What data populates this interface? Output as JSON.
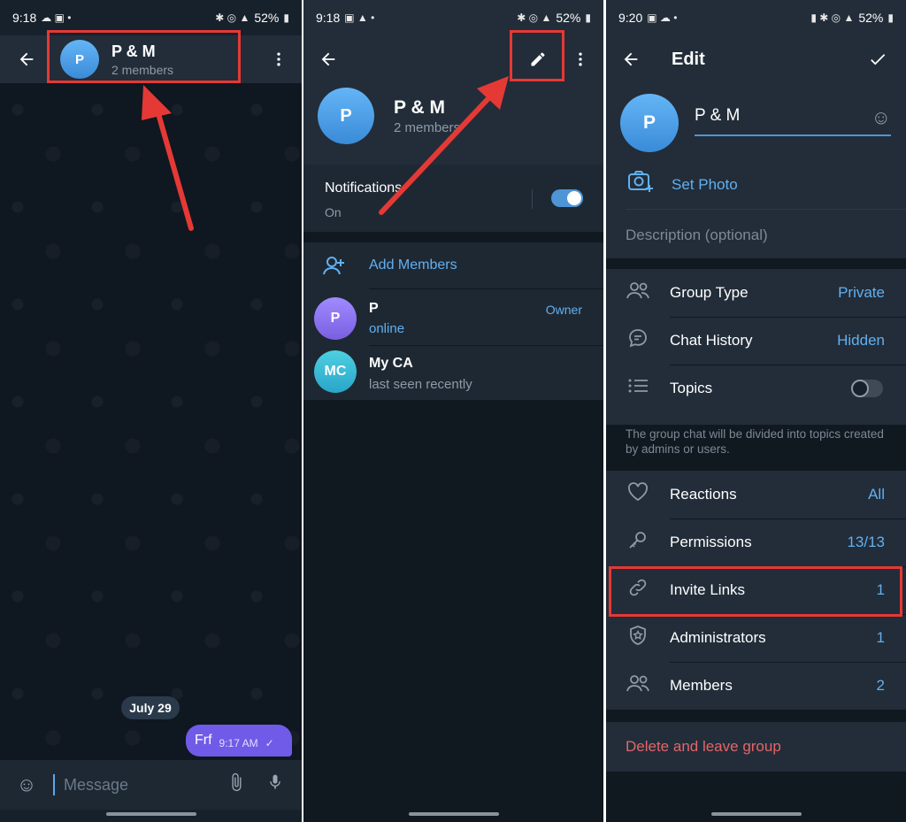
{
  "status_bar": [
    {
      "time": "9:18",
      "battery": "52%"
    },
    {
      "time": "9:18",
      "battery": "52%"
    },
    {
      "time": "9:20",
      "battery": "52%"
    }
  ],
  "chat": {
    "title": "P & M",
    "subtitle": "2 members",
    "avatar_letter": "P",
    "date_chip": "July 29",
    "message_text": "Frf",
    "message_time": "9:17 AM",
    "composer_placeholder": "Message"
  },
  "info": {
    "title": "P & M",
    "subtitle": "2 members",
    "avatar_letter": "P",
    "notifications_label": "Notifications",
    "notifications_state": "On",
    "add_members_label": "Add Members",
    "members": [
      {
        "initials": "P",
        "name": "P",
        "status": "online",
        "role": "Owner"
      },
      {
        "initials": "MC",
        "name": "My CA",
        "status": "last seen recently",
        "role": ""
      }
    ]
  },
  "edit": {
    "header_title": "Edit",
    "group_name": "P & M",
    "avatar_letter": "P",
    "set_photo_label": "Set Photo",
    "description_placeholder": "Description (optional)",
    "settings": [
      {
        "label": "Group Type",
        "value": "Private",
        "icon": "people-icon"
      },
      {
        "label": "Chat History",
        "value": "Hidden",
        "icon": "chat-bubble-icon"
      },
      {
        "label": "Topics",
        "value": "",
        "icon": "list-icon"
      }
    ],
    "topics_note": "The group chat will be divided into topics created by admins or users.",
    "management": [
      {
        "label": "Reactions",
        "value": "All",
        "icon": "heart-icon"
      },
      {
        "label": "Permissions",
        "value": "13/13",
        "icon": "key-icon"
      },
      {
        "label": "Invite Links",
        "value": "1",
        "icon": "link-icon"
      },
      {
        "label": "Administrators",
        "value": "1",
        "icon": "shield-icon"
      },
      {
        "label": "Members",
        "value": "2",
        "icon": "people-icon"
      }
    ],
    "delete_label": "Delete and leave group"
  },
  "colors": {
    "background": "#17212b",
    "header": "#222d39",
    "accent": "#62b0f0",
    "danger": "#e5646a",
    "highlight_box": "#e53935",
    "bubble": "#6f5be8"
  }
}
